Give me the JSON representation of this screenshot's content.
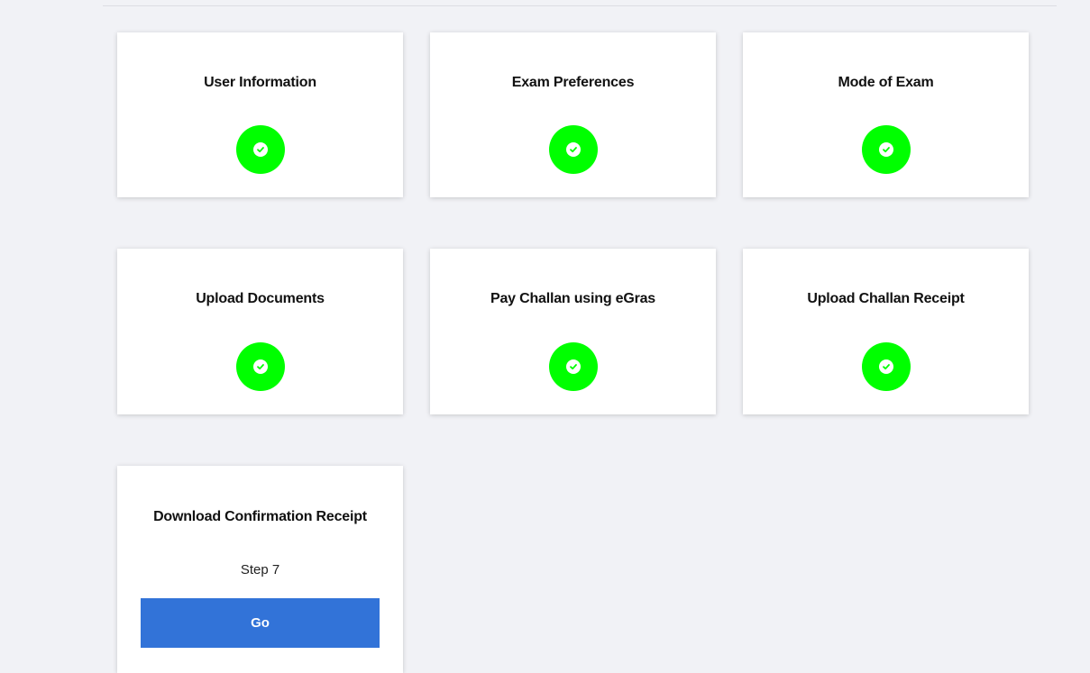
{
  "steps": [
    {
      "title": "User Information",
      "status": "completed",
      "icon": "check-circle-icon"
    },
    {
      "title": "Exam Preferences",
      "status": "completed",
      "icon": "check-circle-icon"
    },
    {
      "title": "Mode of Exam",
      "status": "completed",
      "icon": "check-circle-icon"
    },
    {
      "title": "Upload Documents",
      "status": "completed",
      "icon": "check-circle-icon"
    },
    {
      "title": "Pay Challan using eGras",
      "status": "completed",
      "icon": "check-circle-icon"
    },
    {
      "title": "Upload Challan Receipt",
      "status": "completed",
      "icon": "check-circle-icon"
    },
    {
      "title": "Download Confirmation Receipt",
      "status": "pending",
      "step_label": "Step 7",
      "button_label": "Go"
    }
  ],
  "colors": {
    "completed": "#00ff00",
    "button": "#3273d8",
    "background": "#f1f2f6"
  }
}
